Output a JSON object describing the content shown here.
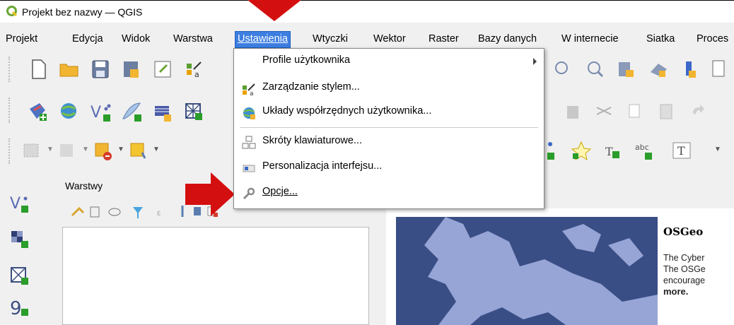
{
  "window": {
    "title": "Projekt bez nazwy — QGIS"
  },
  "menubar": {
    "items": [
      {
        "label": "Projekt"
      },
      {
        "label": "Edycja"
      },
      {
        "label": "Widok"
      },
      {
        "label": "Warstwa"
      },
      {
        "label": "Ustawienia"
      },
      {
        "label": "Wtyczki"
      },
      {
        "label": "Wektor"
      },
      {
        "label": "Raster"
      },
      {
        "label": "Bazy danych"
      },
      {
        "label": "W internecie"
      },
      {
        "label": "Siatka"
      },
      {
        "label": "Proces"
      }
    ]
  },
  "settings_menu": {
    "items": [
      {
        "label": "Profile użytkownika"
      },
      {
        "label": "Zarządzanie stylem..."
      },
      {
        "label": "Układy współrzędnych użytkownika..."
      },
      {
        "label": "Skróty klawiaturowe..."
      },
      {
        "label": "Personalizacja interfejsu..."
      },
      {
        "label": "Opcje..."
      }
    ]
  },
  "layers_panel": {
    "title": "Warstwy"
  },
  "news": {
    "heading": "OSGeo",
    "line1": "The Cyber",
    "line2": "The OSGe",
    "line3": "encourage",
    "more": "more."
  },
  "colors": {
    "accent": "#3d7ee0",
    "annotation": "#d40f0f",
    "map_water": "#3a4e86",
    "map_land": "#97a5d6"
  }
}
